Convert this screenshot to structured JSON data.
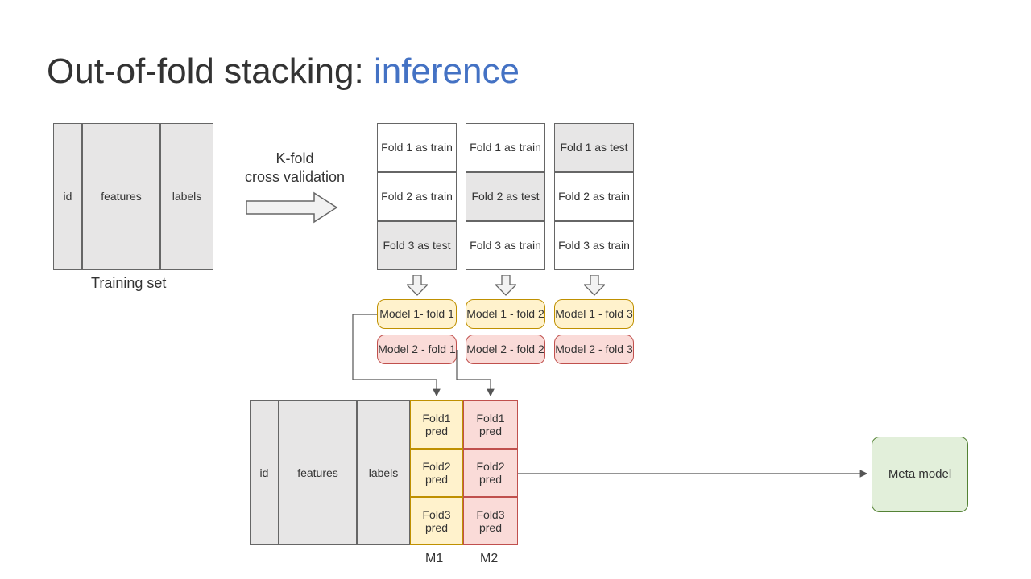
{
  "title_main": "Out-of-fold stacking: ",
  "title_accent": "inference",
  "training_set": {
    "id": "id",
    "features": "features",
    "labels": "labels",
    "caption": "Training set"
  },
  "kfold_label_line1": "K-fold",
  "kfold_label_line2": "cross validation",
  "folds": {
    "col1": [
      "Fold 1 as train",
      "Fold 2 as train",
      "Fold 3 as test"
    ],
    "col2": [
      "Fold 1 as train",
      "Fold 2 as test",
      "Fold 3 as train"
    ],
    "col3": [
      "Fold 1 as test",
      "Fold 2 as train",
      "Fold 3 as train"
    ]
  },
  "models": {
    "m1": [
      "Model 1- fold 1",
      "Model 1 - fold 2",
      "Model 1 - fold 3"
    ],
    "m2": [
      "Model 2 - fold 1",
      "Model 2 - fold 2",
      "Model 2 - fold 3"
    ]
  },
  "stacked": {
    "id": "id",
    "features": "features",
    "labels": "labels",
    "m1_preds": [
      "Fold1 pred",
      "Fold2 pred",
      "Fold3 pred"
    ],
    "m2_preds": [
      "Fold1 pred",
      "Fold2 pred",
      "Fold3 pred"
    ],
    "m1_label": "M1",
    "m2_label": "M2"
  },
  "meta": "Meta model"
}
